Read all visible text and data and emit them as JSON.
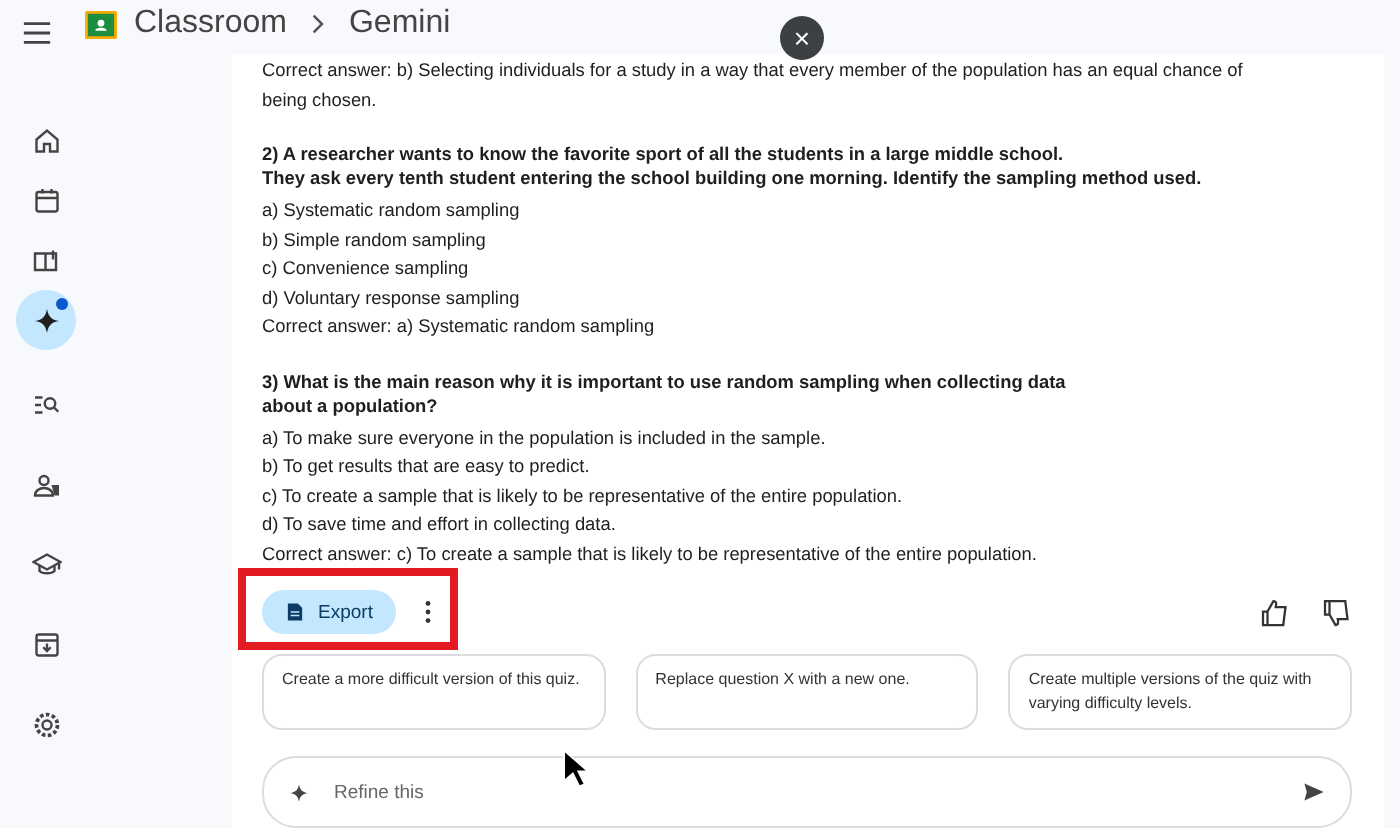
{
  "header": {
    "app": "Classroom",
    "section": "Gemini"
  },
  "sidebar": [
    {
      "kind": "home",
      "selected": false,
      "dot": false
    },
    {
      "kind": "calendar",
      "selected": false,
      "dot": false
    },
    {
      "kind": "book",
      "selected": false,
      "dot": false
    },
    {
      "kind": "sparkle",
      "selected": true,
      "dot": true
    },
    {
      "kind": "search-list",
      "selected": false,
      "dot": false
    },
    {
      "kind": "people",
      "selected": false,
      "dot": false
    },
    {
      "kind": "school",
      "selected": false,
      "dot": false
    },
    {
      "kind": "archive",
      "selected": false,
      "dot": false
    },
    {
      "kind": "settings",
      "selected": false,
      "dot": false
    }
  ],
  "content": [
    {
      "kind": "answer",
      "text": "Correct answer: b) Selecting individuals for a study in a way that every member of the population has an equal chance of being chosen."
    },
    {
      "kind": "question",
      "text": "2) A researcher wants to know the favorite sport of all the students in a large middle school.\nThey ask every tenth student entering the school building one morning. Identify the sampling method used."
    },
    {
      "kind": "option",
      "text": "a) Systematic random sampling"
    },
    {
      "kind": "option",
      "text": "b) Simple random sampling"
    },
    {
      "kind": "option",
      "text": "c) Convenience sampling"
    },
    {
      "kind": "option",
      "text": "d) Voluntary response sampling"
    },
    {
      "kind": "answer",
      "text": "Correct answer: a) Systematic random sampling"
    },
    {
      "kind": "question",
      "text": "3) What is the main reason why it is important to use random sampling when collecting data\nabout a population?"
    },
    {
      "kind": "option",
      "text": "a) To make sure everyone in the population is included in the sample."
    },
    {
      "kind": "option",
      "text": "b) To get results that are easy to predict."
    },
    {
      "kind": "option",
      "text": "c) To create a sample that is likely to be representative of the entire population."
    },
    {
      "kind": "option",
      "text": "d) To save time and effort in collecting data."
    },
    {
      "kind": "answer",
      "text": "Correct answer: c) To create a sample that is likely to be representative of the entire population."
    }
  ],
  "export_button": "Export",
  "suggestions": [
    "Create a more difficult version of this quiz.",
    "Replace question X with a new one.",
    "Create multiple versions of the quiz with varying difficulty levels."
  ],
  "input": {
    "placeholder": "Refine this"
  },
  "close_button": "×"
}
